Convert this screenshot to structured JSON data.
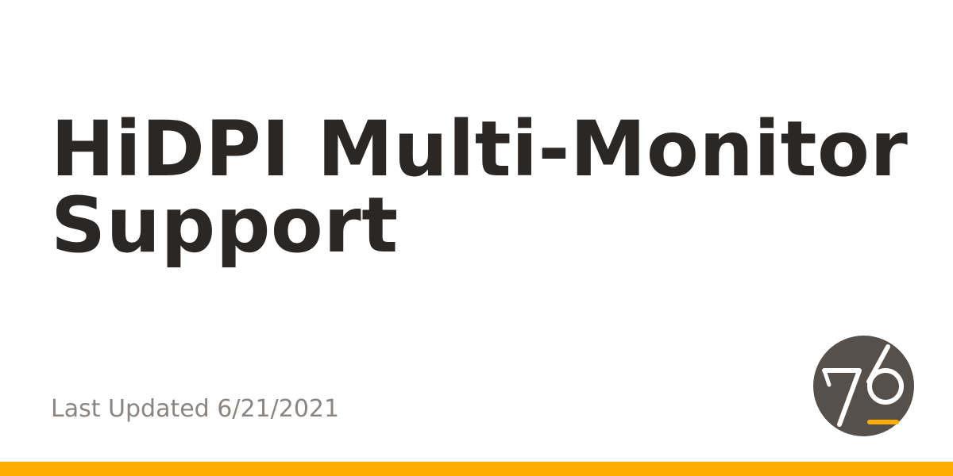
{
  "title": {
    "line1": "HiDPI Multi-Monitor",
    "line2": "Support"
  },
  "last_updated": {
    "text": "Last Updated 6/21/2021"
  },
  "logo": {
    "icon": "system76-logo-icon",
    "text": "76",
    "circle_color": "#574f4a",
    "mark_color": "#ffffff",
    "underline_color": "#ffad00"
  },
  "colors": {
    "title": "#2b2724",
    "subtitle": "#8a8581",
    "accent_bar": "#ffad00",
    "background": "#ffffff"
  }
}
